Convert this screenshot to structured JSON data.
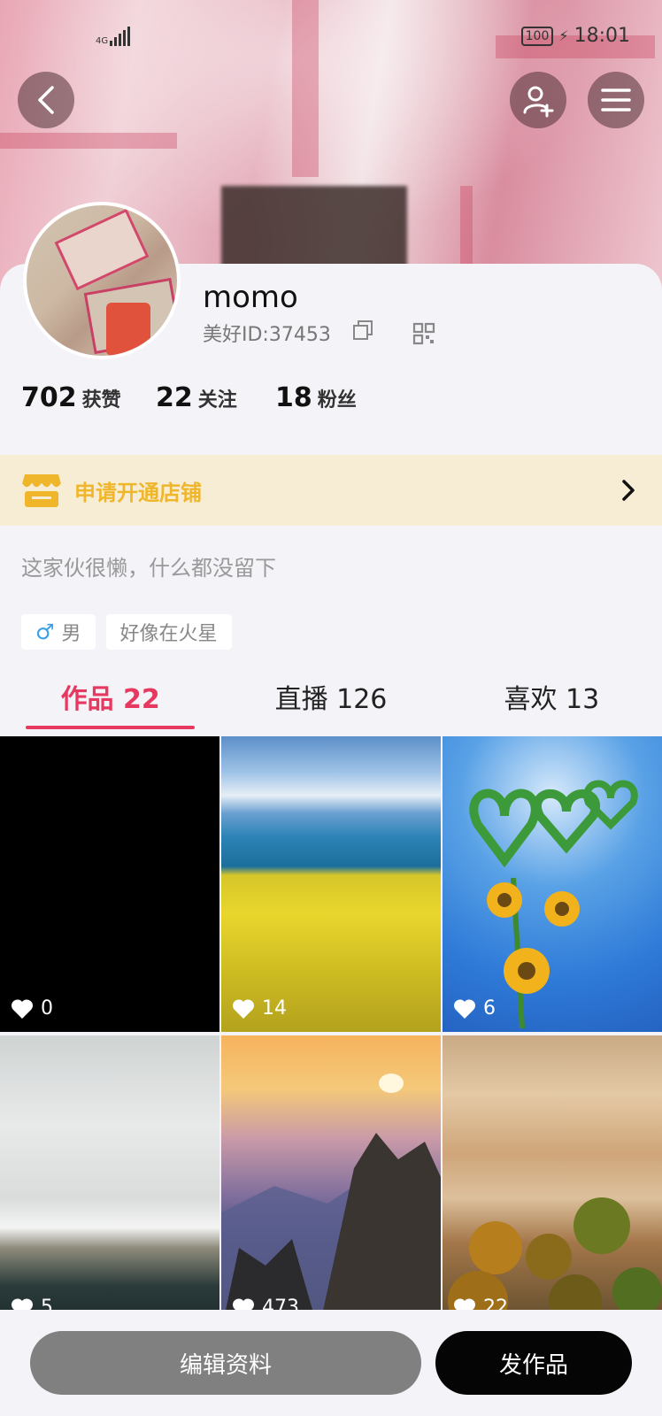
{
  "status_bar": {
    "network": "4G",
    "battery": "100",
    "time": "18:01"
  },
  "profile": {
    "username": "momo",
    "id_text": "美好ID:37453",
    "stats": [
      {
        "value": "702",
        "label": "获赞"
      },
      {
        "value": "22",
        "label": "关注"
      },
      {
        "value": "18",
        "label": "粉丝"
      }
    ],
    "bio": "这家伙很懒，什么都没留下",
    "tags": [
      {
        "icon": "male-icon",
        "label": "男"
      },
      {
        "label": "好像在火星"
      }
    ]
  },
  "shop_banner": {
    "label": "申请开通店铺"
  },
  "tabs": [
    {
      "label": "作品 22",
      "active": true
    },
    {
      "label": "直播 126",
      "active": false
    },
    {
      "label": "喜欢 13",
      "active": false
    }
  ],
  "grid": [
    {
      "likes": "0",
      "scene": "black"
    },
    {
      "likes": "14",
      "scene": "lake-flowers"
    },
    {
      "likes": "6",
      "scene": "heart-flowers"
    },
    {
      "likes": "5",
      "scene": "cotton-tank"
    },
    {
      "likes": "473",
      "scene": "mountain-sunset"
    },
    {
      "likes": "22",
      "scene": "desert-trees"
    }
  ],
  "buttons": {
    "edit": "编辑资料",
    "post": "发作品"
  },
  "colors": {
    "accent": "#e7395f",
    "shop_text": "#f0b62b",
    "shop_bg": "#f6edd4"
  }
}
